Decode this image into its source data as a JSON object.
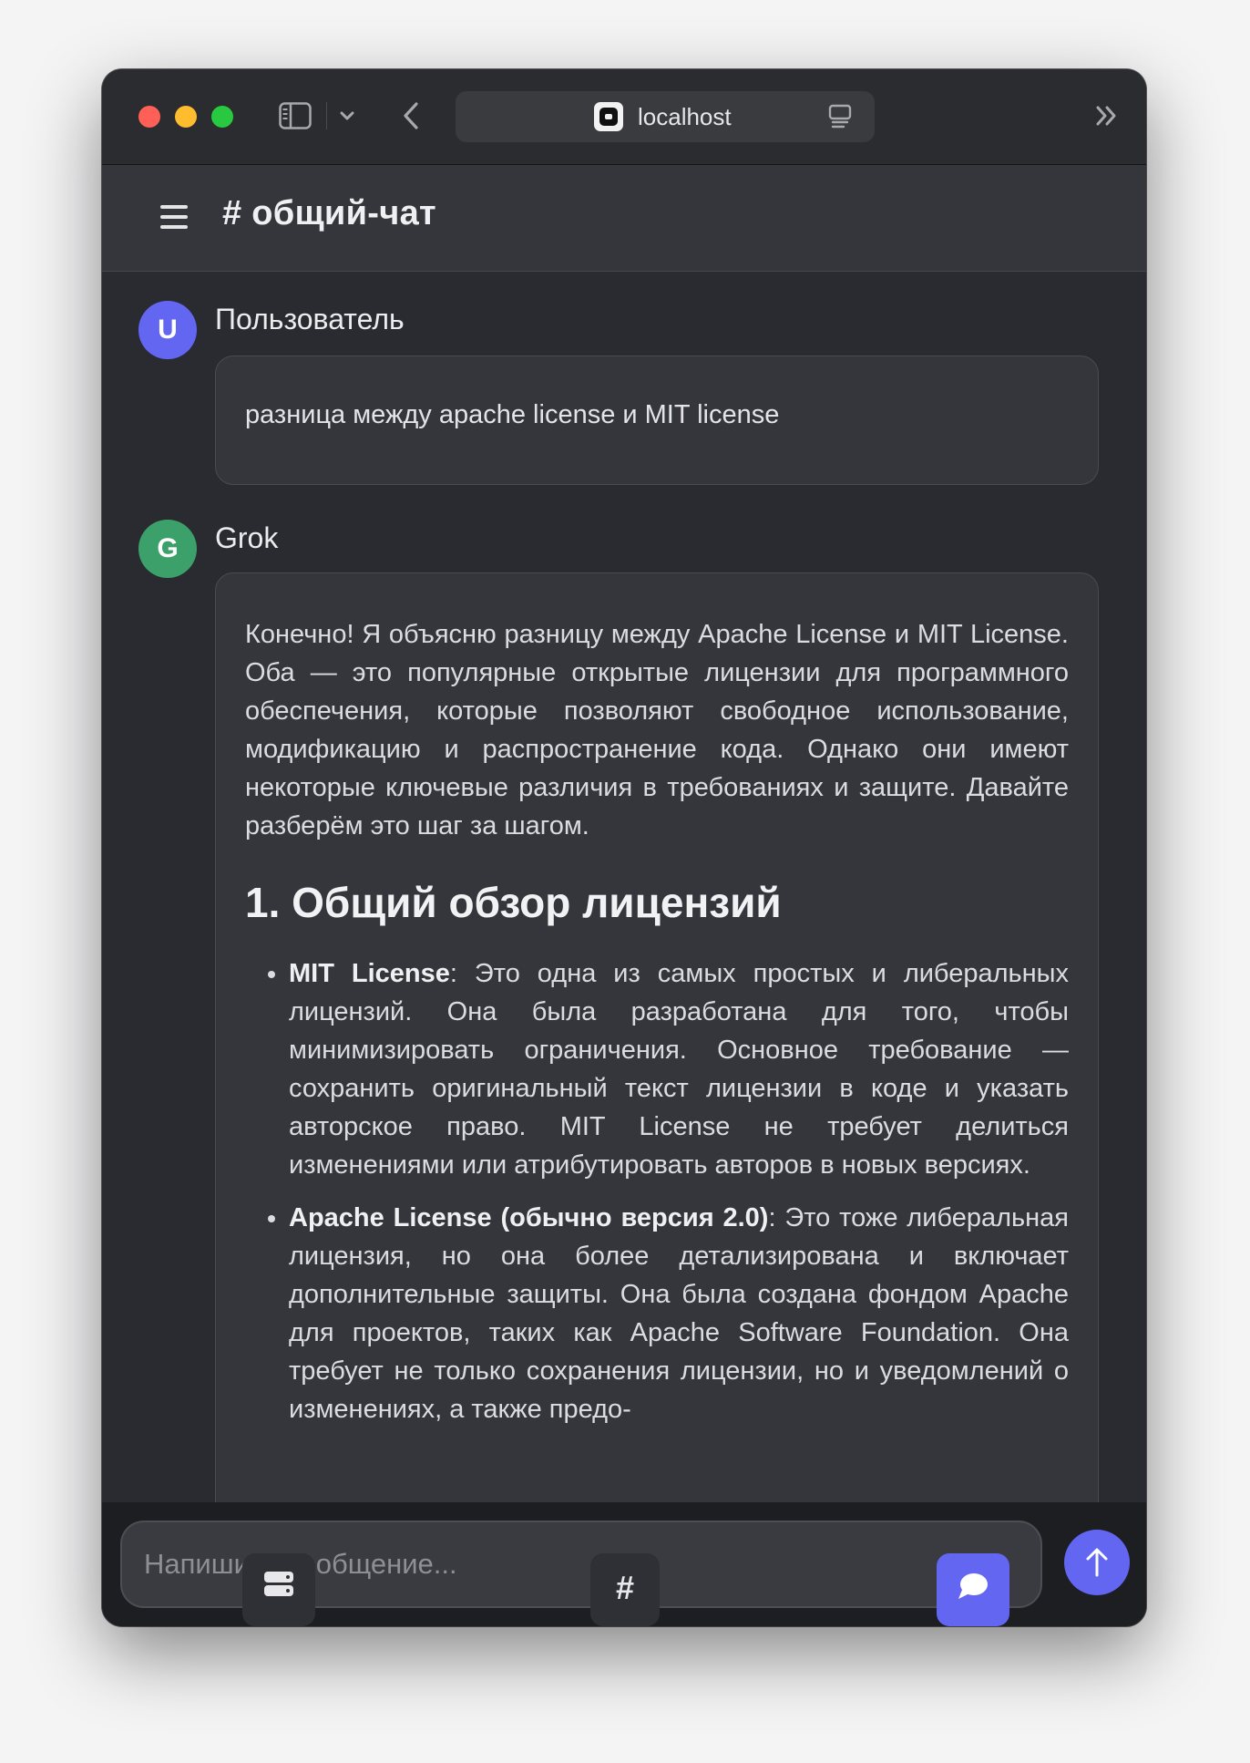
{
  "browser": {
    "url": "localhost"
  },
  "channel": {
    "title": "# общий-чат"
  },
  "messages": [
    {
      "avatar_letter": "U",
      "author": "Пользователь",
      "text": "разница между apache license и MIT license",
      "avatar_color": "#6366f1"
    },
    {
      "avatar_letter": "G",
      "author": "Grok",
      "avatar_color": "#3ca06a",
      "intro": "Конечно! Я объясню разницу между Apache License и MIT License. Оба — это популярные открытые лицензии для программного обеспечения, которые позволяют свободное использование, модификацию и распространение кода. Однако они имеют некоторые ключевые различия в требованиях и защите. Давайте разберём это шаг за шагом.",
      "heading": "1. Общий обзор лицензий",
      "bullets": [
        {
          "bold": "MIT License",
          "text": ": Это одна из самых простых и либеральных лицензий. Она была разработана для того, чтобы минимизировать ограничения. Основное требование — сохранить оригинальный текст лицензии в коде и указать авторское право. MIT License не требует делиться изменениями или атрибутировать авторов в новых версиях."
        },
        {
          "bold": "Apache License (обычно версия 2.0)",
          "text": ": Это тоже либеральная лицензия, но она более детализирована и включает дополнительные защиты. Она была создана фондом Apache для проектов, таких как Apache Software Foundation. Она требует не только сохранения лицензии, но и уведомлений о изменениях, а также предо-"
        }
      ]
    }
  ],
  "composer": {
    "placeholder": "Напишите сообщение..."
  },
  "nav": {
    "channels_label": "#"
  },
  "colors": {
    "accent": "#6366f1",
    "grok_avatar": "#3ca06a",
    "background": "#2a2b30"
  }
}
